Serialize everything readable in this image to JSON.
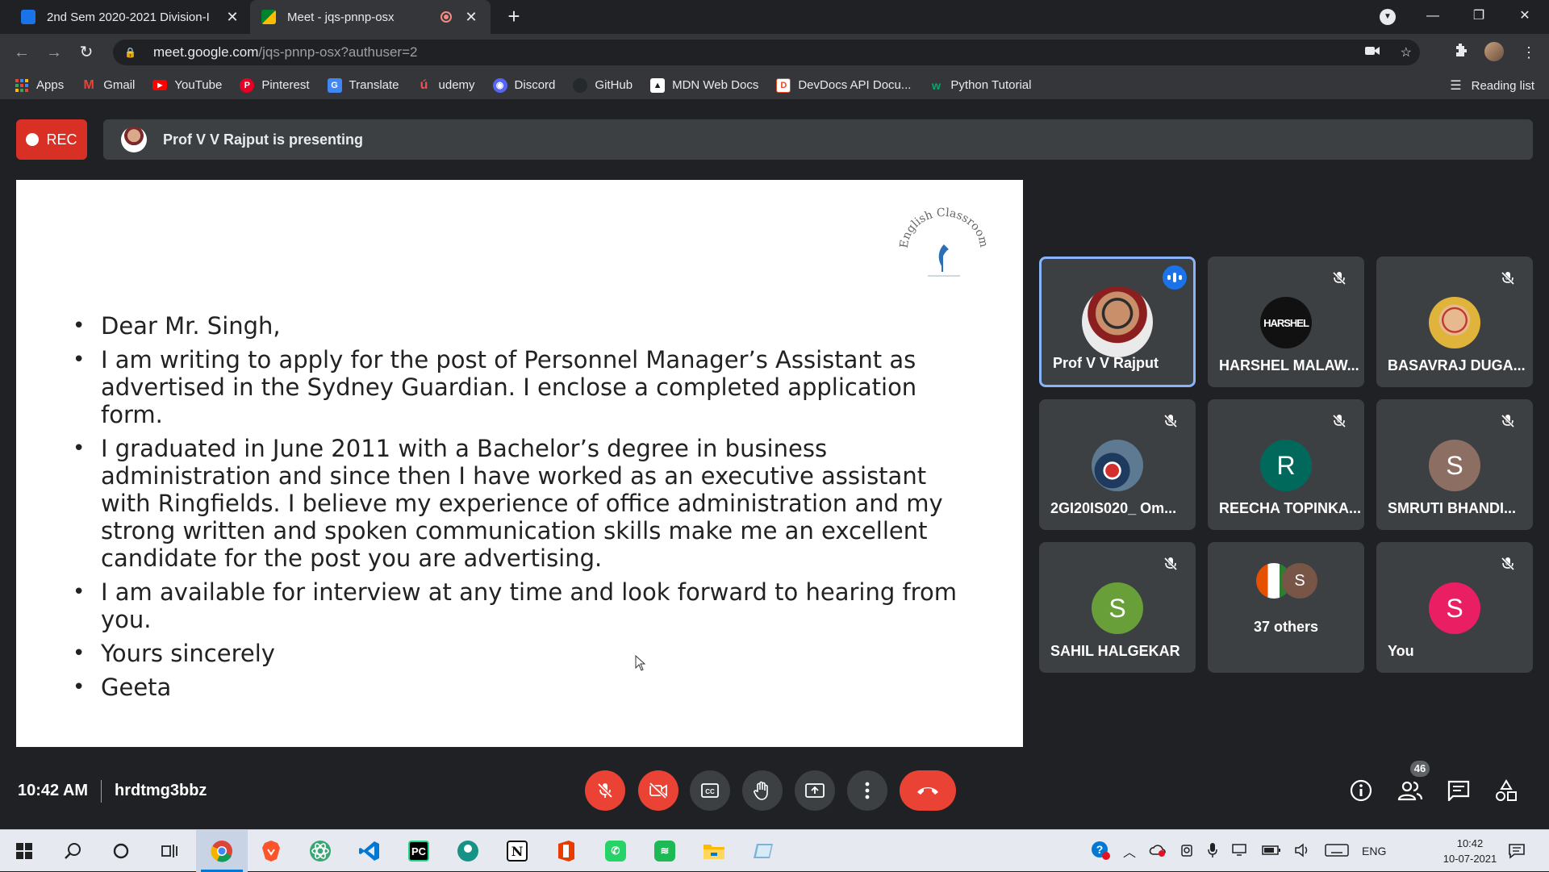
{
  "browser": {
    "tabs": [
      {
        "title": "2nd Sem 2020-2021 Division-I",
        "favicon": "classroom-icon",
        "color": "#1a73e8"
      },
      {
        "title": "Meet - jqs-pnnp-osx",
        "favicon": "meet-icon",
        "color": "#00832d"
      }
    ],
    "url_host": "meet.google.com",
    "url_path": "/jqs-pnnp-osx?authuser=2",
    "bookmarks": [
      {
        "label": "Apps",
        "icon": "apps-grid-icon",
        "color": "#4285f4"
      },
      {
        "label": "Gmail",
        "icon": "gmail-icon",
        "color": "#ea4335"
      },
      {
        "label": "YouTube",
        "icon": "youtube-icon",
        "color": "#ff0000"
      },
      {
        "label": "Pinterest",
        "icon": "pinterest-icon",
        "color": "#e60023"
      },
      {
        "label": "Translate",
        "icon": "translate-icon",
        "color": "#4285f4"
      },
      {
        "label": "udemy",
        "icon": "udemy-icon",
        "color": "#a435f0"
      },
      {
        "label": "Discord",
        "icon": "discord-icon",
        "color": "#5865f2"
      },
      {
        "label": "GitHub",
        "icon": "github-icon",
        "color": "#24292e"
      },
      {
        "label": "MDN Web Docs",
        "icon": "mdn-icon",
        "color": "#1b1b1b"
      },
      {
        "label": "DevDocs API Docu...",
        "icon": "devdocs-icon",
        "color": "#e34c26"
      },
      {
        "label": "Python Tutorial",
        "icon": "w3schools-icon",
        "color": "#04aa6d"
      }
    ],
    "reading_list": "Reading list"
  },
  "meet": {
    "rec_label": "REC",
    "presenting_text": "Prof V V Rajput is presenting",
    "slide": {
      "logo_text": "English Classroom",
      "bullets": [
        "Dear Mr. Singh,",
        "I am writing to apply for the post of Personnel Manager’s Assistant as advertised in the Sydney Guardian. I enclose a completed application form.",
        "I graduated in June 2011 with a Bachelor’s degree in business administration and since then I have worked as an executive assistant with Ringfields. I believe my experience of office administration and my strong written and spoken communication skills make me an excellent candidate for the post you are advertising.",
        "I am available for interview at any time and look forward to hearing from you.",
        "Yours sincerely",
        "Geeta"
      ]
    },
    "participants": [
      {
        "name": "Prof V V Rajput",
        "avatar": "photo",
        "muted": false,
        "speaking": true,
        "avatar_color": "#8a6d5a"
      },
      {
        "name": "HARSHEL MALAW...",
        "avatar": "HARSHEL",
        "muted": true,
        "avatar_color": "#111111"
      },
      {
        "name": "BASAVRAJ DUGA...",
        "avatar": "photo",
        "muted": true,
        "avatar_color": "#d4a23a"
      },
      {
        "name": "2GI20IS020_ Om...",
        "avatar": "photo",
        "muted": true,
        "avatar_color": "#2b3a4a"
      },
      {
        "name": "REECHA TOPINKA...",
        "avatar": "R",
        "muted": true,
        "avatar_color": "#00695c"
      },
      {
        "name": "SMRUTI BHANDI...",
        "avatar": "S",
        "muted": true,
        "avatar_color": "#8d6e63"
      },
      {
        "name": "SAHIL HALGEKAR",
        "avatar": "S",
        "muted": true,
        "avatar_color": "#689f38"
      },
      {
        "name": "37 others",
        "avatar": "S",
        "muted": false,
        "avatar_color": "#795548"
      },
      {
        "name": "You",
        "avatar": "S",
        "muted": true,
        "avatar_color": "#e91e63"
      }
    ],
    "footer": {
      "time": "10:42 AM",
      "meeting_code": "hrdtmg3bbz",
      "participant_count": "46"
    }
  },
  "taskbar": {
    "language": "ENG",
    "clock_time": "10:42",
    "clock_date": "10-07-2021"
  }
}
